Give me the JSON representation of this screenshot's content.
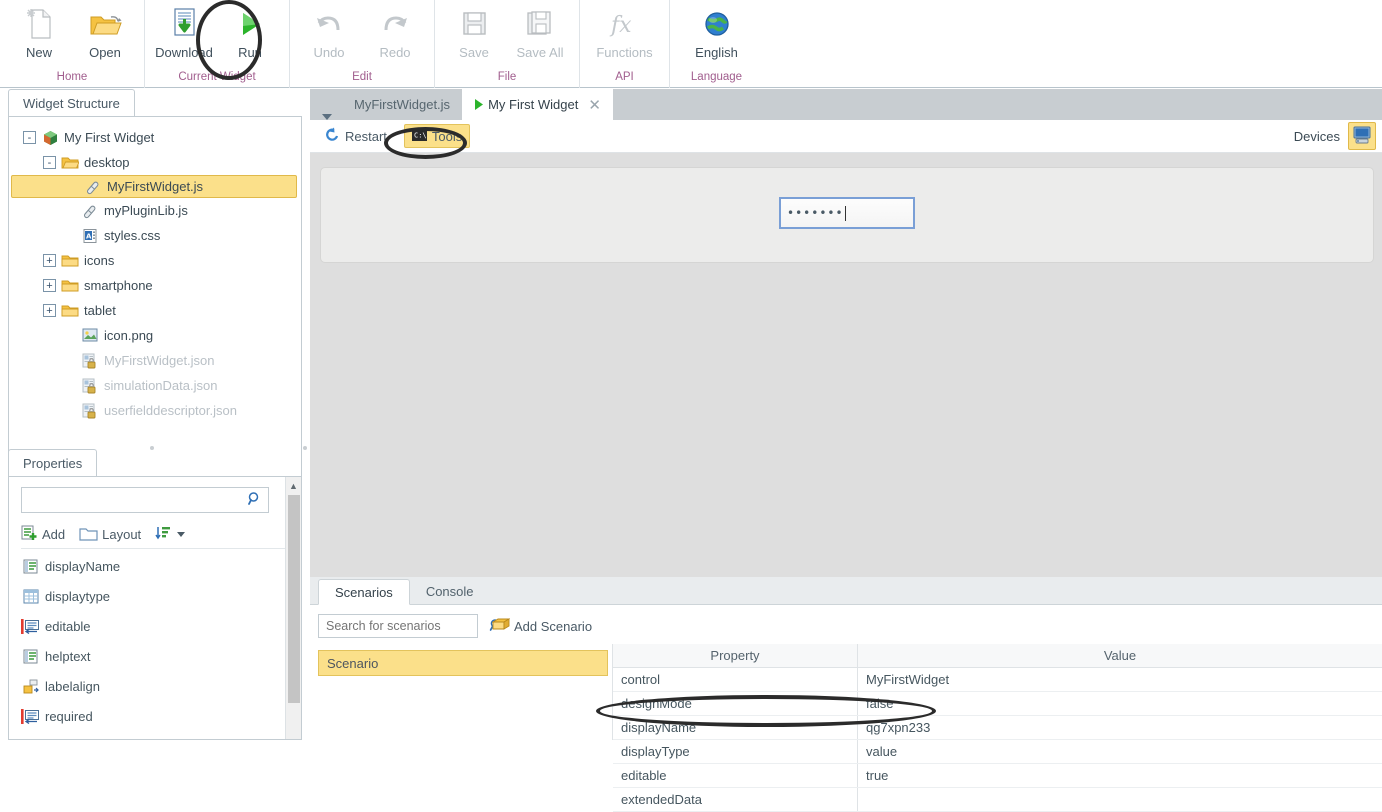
{
  "ribbon": {
    "groups": [
      {
        "name": "Home",
        "buttons": [
          {
            "label": "New",
            "icon": "new-document-icon",
            "disabled": false
          },
          {
            "label": "Open",
            "icon": "open-folder-icon",
            "disabled": false
          }
        ]
      },
      {
        "name": "Current Widget",
        "buttons": [
          {
            "label": "Download",
            "icon": "download-icon",
            "disabled": false
          },
          {
            "label": "Run",
            "icon": "run-play-icon",
            "disabled": false
          }
        ]
      },
      {
        "name": "Edit",
        "buttons": [
          {
            "label": "Undo",
            "icon": "undo-icon",
            "disabled": true
          },
          {
            "label": "Redo",
            "icon": "redo-icon",
            "disabled": true
          }
        ]
      },
      {
        "name": "File",
        "buttons": [
          {
            "label": "Save",
            "icon": "save-icon",
            "disabled": true
          },
          {
            "label": "Save All",
            "icon": "save-all-icon",
            "disabled": true
          }
        ]
      },
      {
        "name": "API",
        "buttons": [
          {
            "label": "Functions",
            "icon": "functions-fx-icon",
            "disabled": true
          }
        ]
      },
      {
        "name": "Language",
        "buttons": [
          {
            "label": "English",
            "icon": "globe-icon",
            "disabled": false
          }
        ]
      }
    ]
  },
  "widget_structure": {
    "tab_label": "Widget Structure",
    "tree": [
      {
        "label": "My First Widget",
        "icon": "widget-cube-icon",
        "indent": 0,
        "expander": "-",
        "selected": false,
        "dim": false
      },
      {
        "label": "desktop",
        "icon": "folder-open-icon",
        "indent": 1,
        "expander": "-",
        "selected": false,
        "dim": false
      },
      {
        "label": "MyFirstWidget.js",
        "icon": "js-file-icon",
        "indent": 2,
        "expander": "",
        "selected": true,
        "dim": false
      },
      {
        "label": "myPluginLib.js",
        "icon": "js-file-icon",
        "indent": 2,
        "expander": "",
        "selected": false,
        "dim": false
      },
      {
        "label": "styles.css",
        "icon": "css-file-icon",
        "indent": 2,
        "expander": "",
        "selected": false,
        "dim": false
      },
      {
        "label": "icons",
        "icon": "folder-icon",
        "indent": 1,
        "expander": "+",
        "selected": false,
        "dim": false
      },
      {
        "label": "smartphone",
        "icon": "folder-icon",
        "indent": 1,
        "expander": "+",
        "selected": false,
        "dim": false
      },
      {
        "label": "tablet",
        "icon": "folder-icon",
        "indent": 1,
        "expander": "+",
        "selected": false,
        "dim": false
      },
      {
        "label": "icon.png",
        "icon": "image-file-icon",
        "indent": 2,
        "expander": "",
        "selected": false,
        "dim": false
      },
      {
        "label": "MyFirstWidget.json",
        "icon": "locked-json-icon",
        "indent": 2,
        "expander": "",
        "selected": false,
        "dim": true
      },
      {
        "label": "simulationData.json",
        "icon": "locked-json-icon",
        "indent": 2,
        "expander": "",
        "selected": false,
        "dim": true
      },
      {
        "label": "userfielddescriptor.json",
        "icon": "locked-json-icon",
        "indent": 2,
        "expander": "",
        "selected": false,
        "dim": true
      }
    ]
  },
  "properties": {
    "tab_label": "Properties",
    "search_value": "",
    "search_placeholder": "",
    "tools": [
      {
        "label": "Add",
        "icon": "add-property-icon"
      },
      {
        "label": "Layout",
        "icon": "layout-folder-icon"
      },
      {
        "label": "",
        "icon": "sort-icon"
      }
    ],
    "items": [
      {
        "label": "displayName",
        "icon": "list-property-icon",
        "marker": false
      },
      {
        "label": "displaytype",
        "icon": "table-property-icon",
        "marker": false
      },
      {
        "label": "editable",
        "icon": "boolean-property-icon",
        "marker": true
      },
      {
        "label": "helptext",
        "icon": "list-property-icon",
        "marker": false
      },
      {
        "label": "labelalign",
        "icon": "align-property-icon",
        "marker": false
      },
      {
        "label": "required",
        "icon": "boolean-property-icon",
        "marker": true
      }
    ]
  },
  "main": {
    "tabs": [
      {
        "label": "MyFirstWidget.js",
        "active": false,
        "icon": "",
        "closable": false
      },
      {
        "label": "My First Widget",
        "active": true,
        "icon": "run-play-icon",
        "closable": true
      }
    ],
    "toolbar": {
      "restart_label": "Restart",
      "restart_icon": "restart-icon",
      "tools_label": "Tools",
      "tools_icon": "console-icon",
      "devices_label": "Devices",
      "device_icon": "desktop-monitor-icon"
    },
    "preview": {
      "password_value": "•••••••",
      "field_type": "password"
    }
  },
  "dock": {
    "tabs": [
      {
        "label": "Scenarios",
        "active": true
      },
      {
        "label": "Console",
        "active": false
      }
    ],
    "search_placeholder": "Search for scenarios",
    "search_value": "",
    "add_scenario_label": "Add Scenario",
    "add_scenario_icon": "add-scenario-icon",
    "scenarios": [
      {
        "label": "Scenario",
        "selected": true
      }
    ],
    "table": {
      "headers": [
        "Property",
        "Value"
      ],
      "rows": [
        {
          "property": "control",
          "value": "MyFirstWidget",
          "highlighted": false
        },
        {
          "property": "designMode",
          "value": "false",
          "highlighted": false
        },
        {
          "property": "displayName",
          "value": "qg7xpn233",
          "highlighted": false
        },
        {
          "property": "displayType",
          "value": "value",
          "highlighted": false
        },
        {
          "property": "editable",
          "value": "true",
          "highlighted": true
        },
        {
          "property": "extendedData",
          "value": "",
          "highlighted": false
        }
      ]
    }
  },
  "colors": {
    "highlight": "#fbe08a",
    "annotation": "#2b2b2b",
    "accent_blue": "#7a9fd6",
    "group_label": "#a15e8e"
  }
}
